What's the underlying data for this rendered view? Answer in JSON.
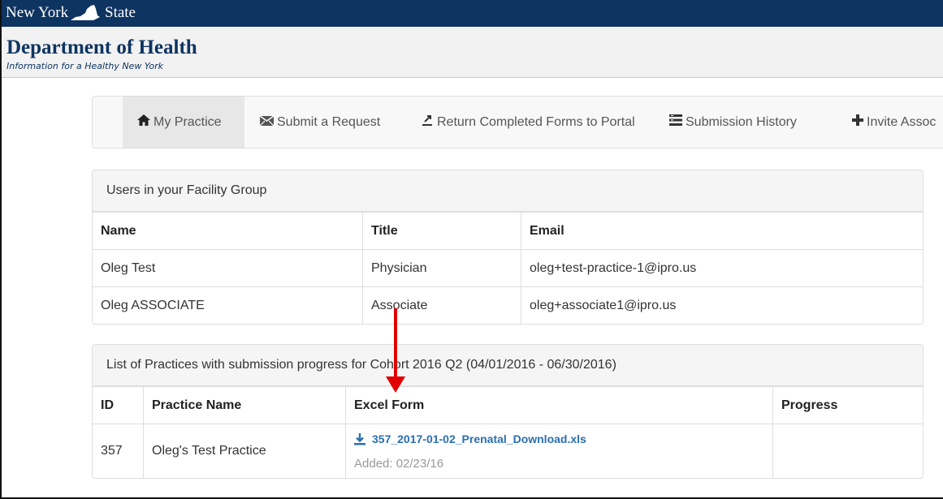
{
  "nys": {
    "left": "New York",
    "right": "State"
  },
  "header": {
    "title": "Department of Health",
    "tagline": "Information for a Healthy New York"
  },
  "nav": {
    "items": [
      {
        "label": "My Practice",
        "icon": "home-icon"
      },
      {
        "label": "Submit a Request",
        "icon": "envelope-icon"
      },
      {
        "label": "Return Completed Forms to Portal",
        "icon": "upload-icon"
      },
      {
        "label": "Submission History",
        "icon": "list-icon"
      },
      {
        "label": "Invite Assoc",
        "icon": "plus-icon"
      }
    ]
  },
  "users_panel": {
    "heading": "Users in your Facility Group",
    "columns": [
      "Name",
      "Title",
      "Email"
    ],
    "rows": [
      {
        "name": "Oleg Test",
        "title": "Physician",
        "email": "oleg+test-practice-1@ipro.us"
      },
      {
        "name": "Oleg ASSOCIATE",
        "title": "Associate",
        "email": "oleg+associate1@ipro.us"
      }
    ]
  },
  "practices_panel": {
    "heading": "List of Practices with submission progress for Cohort 2016 Q2 (04/01/2016 - 06/30/2016)",
    "columns": [
      "ID",
      "Practice Name",
      "Excel Form",
      "Progress"
    ],
    "rows": [
      {
        "id": "357",
        "name": "Oleg's Test Practice",
        "file": "357_2017-01-02_Prenatal_Download.xls",
        "added": "Added: 02/23/16",
        "progress": ""
      }
    ]
  },
  "colors": {
    "nys_bar": "#0e3461",
    "link": "#2a6fb0",
    "annotation_arrow": "#e00000"
  }
}
